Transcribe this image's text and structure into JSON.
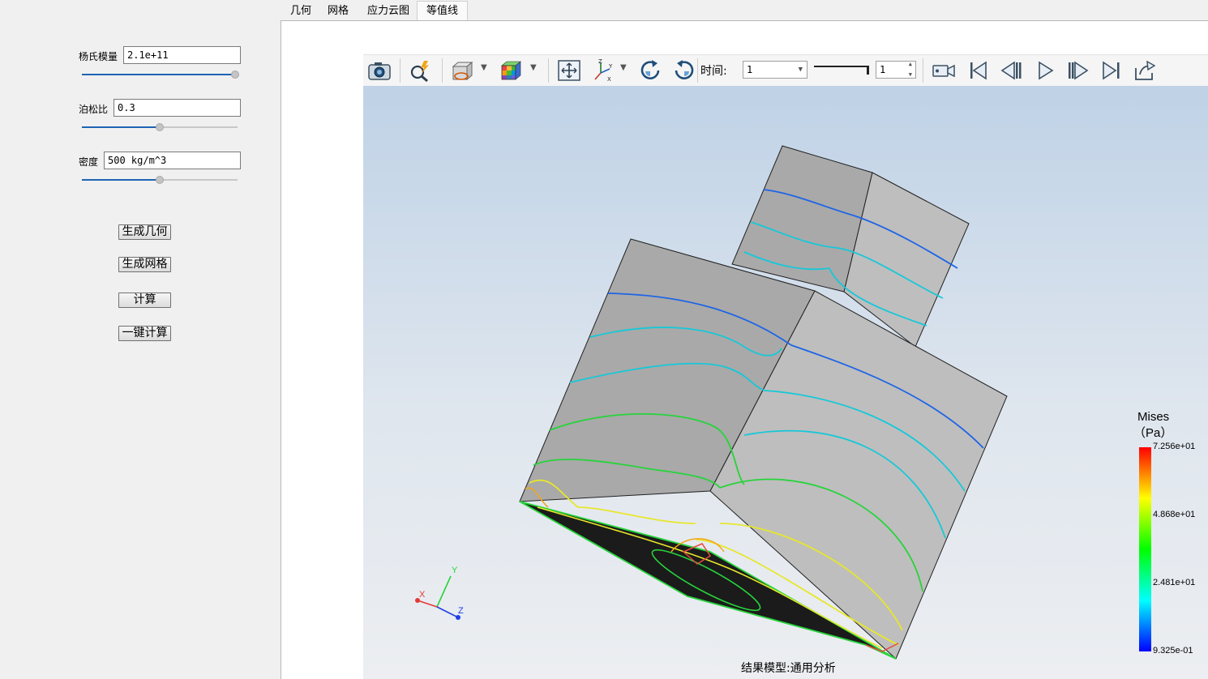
{
  "properties": {
    "young": {
      "label": "杨氏模量",
      "value": "2.1e+11",
      "slider_fraction": 1.0
    },
    "poisson": {
      "label": "泊松比",
      "value": "0.3",
      "slider_fraction": 0.5
    },
    "density": {
      "label": "密度",
      "value": "500 kg/m^3",
      "slider_fraction": 0.5
    }
  },
  "actions": {
    "gen_geometry": "生成几何",
    "gen_mesh": "生成网格",
    "compute": "计算",
    "one_click": "一键计算"
  },
  "tabs": [
    {
      "label": "几何",
      "active": false
    },
    {
      "label": "网格",
      "active": false
    },
    {
      "label": "应力云图",
      "active": false
    },
    {
      "label": "等值线",
      "active": true
    }
  ],
  "toolbar": {
    "time_label": "时间:",
    "time_value": "1",
    "frame_value": "1",
    "icons": [
      "camera-icon",
      "probe-icon",
      "clip-plane-icon",
      "color-cube-icon",
      "fit-view-icon",
      "axes-icon",
      "rotate-cw-icon",
      "rotate-ccw-icon",
      "record-icon",
      "first-frame-icon",
      "prev-frame-icon",
      "play-icon",
      "next-frame-icon",
      "last-frame-icon",
      "export-icon"
    ]
  },
  "legend": {
    "title_line1": "Mises",
    "title_line2": "（Pa）",
    "ticks": [
      "7.256e+01",
      "4.868e+01",
      "2.481e+01",
      "9.325e-01"
    ],
    "colors": [
      "#ff0000",
      "#ffff00",
      "#00ff00",
      "#00ffff",
      "#0000ff"
    ]
  },
  "axes": {
    "x": "X",
    "y": "Y",
    "z": "Z"
  },
  "status": "结果模型:通用分析"
}
